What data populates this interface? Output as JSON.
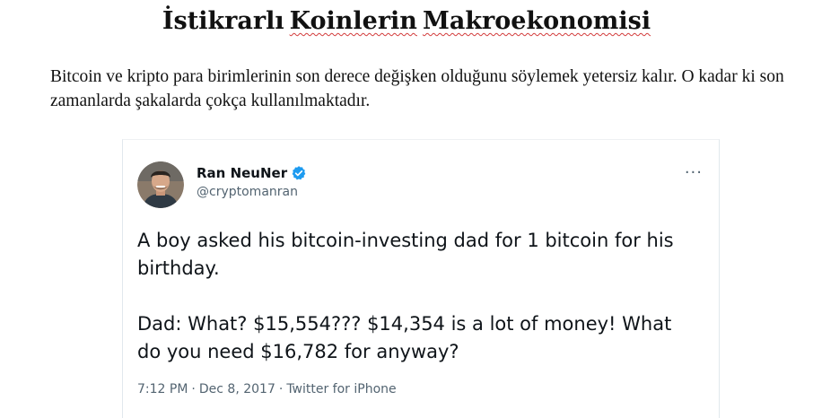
{
  "document": {
    "title_words": [
      "İstikrarlı",
      "Koinlerin",
      "Makroekonomisi"
    ],
    "paragraph": "Bitcoin ve kripto para birimlerinin son derece değişken olduğunu söylemek yetersiz kalır. O kadar ki son zamanlarda şakalarda çokça kullanılmaktadır."
  },
  "tweet": {
    "author_name": "Ran NeuNer",
    "author_handle": "@cryptomanran",
    "verified_icon": "verified-badge-icon",
    "more_icon": "more-options-icon",
    "more_glyph": "···",
    "text_paragraphs": [
      "A boy asked his bitcoin-investing dad for 1 bitcoin for his birthday.",
      "Dad: What? $15,554??? $14,354 is a lot of money! What do you need $16,782 for anyway?"
    ],
    "time": "7:12 PM",
    "date": "Dec 8, 2017",
    "source": "Twitter for iPhone",
    "separator": "·",
    "colors": {
      "verified": "#1d9bf0",
      "meta_text": "#536471",
      "spellcheck_underline": "#d23b3b"
    }
  }
}
